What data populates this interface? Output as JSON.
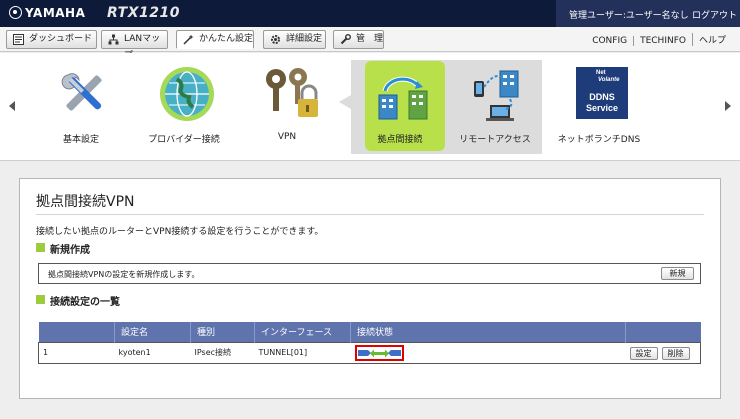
{
  "header": {
    "brand": "YAMAHA",
    "model": "RTX1210",
    "user": "管理ユーザー:ユーザー名なし",
    "logout": "ログアウト"
  },
  "tabs": [
    {
      "label": "ダッシュボード",
      "icon": "dashboard-icon"
    },
    {
      "label": "LANマップ",
      "icon": "lan-map-icon"
    },
    {
      "label": "かんたん設定",
      "icon": "wand-icon",
      "active": true
    },
    {
      "label": "詳細設定",
      "icon": "gear-icon"
    },
    {
      "label": "管　理",
      "icon": "wrench-icon"
    }
  ],
  "links": [
    "CONFIG",
    "TECHINFO",
    "ヘルプ"
  ],
  "carousel": {
    "items": [
      {
        "label": "基本設定",
        "icon": "tools-icon"
      },
      {
        "label": "プロバイダー接続",
        "icon": "globe-icon"
      },
      {
        "label": "VPN",
        "icon": "keys-lock-icon"
      },
      {
        "label": "拠点間接続",
        "icon": "site-to-site-icon",
        "selected": true
      },
      {
        "label": "リモートアクセス",
        "icon": "remote-access-icon"
      },
      {
        "label": "ネットボランチDNS",
        "icon": "netvolante-ddns-icon",
        "badge": [
          "Net",
          "Volante",
          "DDNS",
          "Service"
        ]
      }
    ]
  },
  "page": {
    "title": "拠点間接続VPN",
    "description": "接続したい拠点のルーターとVPN接続する設定を行うことができます。",
    "new_section": {
      "heading": "新規作成",
      "text": "拠点間接続VPNの設定を新規作成します。",
      "button": "新規"
    },
    "list_section": {
      "heading": "接続設定の一覧",
      "columns": [
        "",
        "設定名",
        "種別",
        "インターフェース",
        "接続状態",
        ""
      ],
      "rows": [
        {
          "no": "1",
          "name": "kyoten1",
          "type": "IPsec接続",
          "interface": "TUNNEL[01]",
          "status": "connected",
          "edit": "設定",
          "delete": "削除"
        }
      ]
    }
  },
  "colors": {
    "header_bg": "#0d1a3a",
    "selected_item": "#b8e04a",
    "table_header": "#5f73ad",
    "section_marker": "#9ccc3c",
    "status_highlight": "#e00000"
  }
}
